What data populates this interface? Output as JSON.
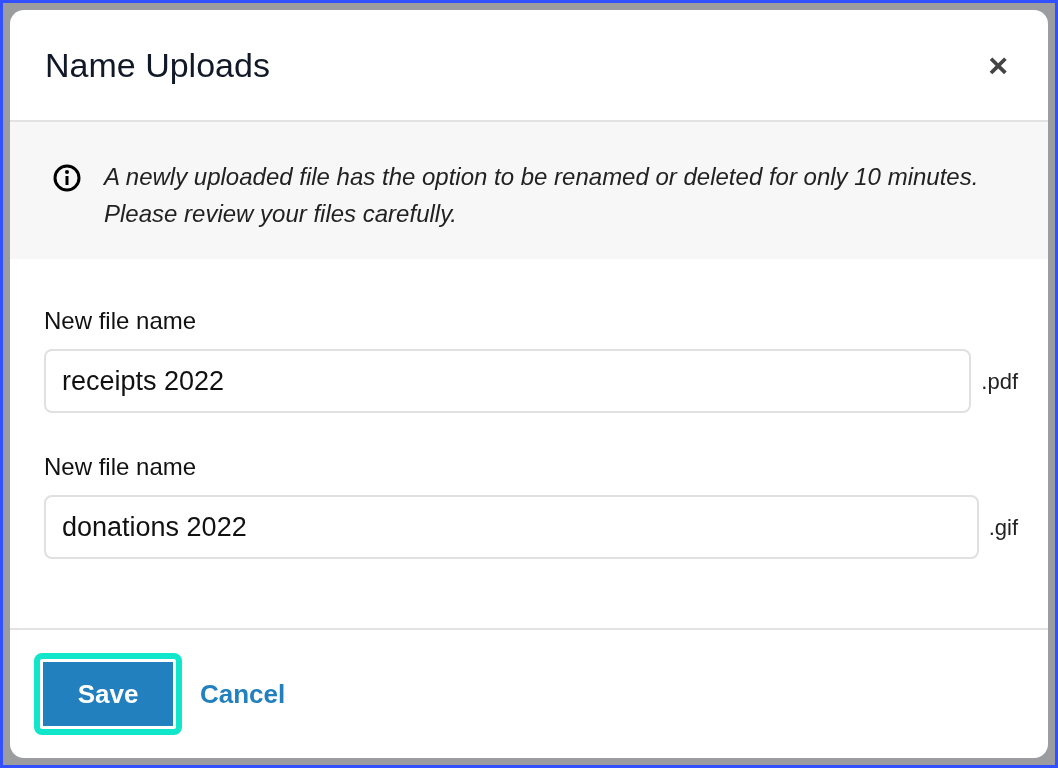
{
  "dialog": {
    "title": "Name Uploads",
    "close": "×"
  },
  "notice": {
    "text": "A newly uploaded file has the option to be renamed or deleted for only 10 minutes. Please review your files carefully."
  },
  "fields": [
    {
      "label": "New file name",
      "value": "receipts 2022",
      "extension": ".pdf"
    },
    {
      "label": "New file name",
      "value": "donations 2022",
      "extension": ".gif"
    }
  ],
  "buttons": [
    {
      "kind": "primary",
      "label": "Save",
      "focused": true
    },
    {
      "kind": "link",
      "label": "Cancel",
      "focused": false
    }
  ]
}
